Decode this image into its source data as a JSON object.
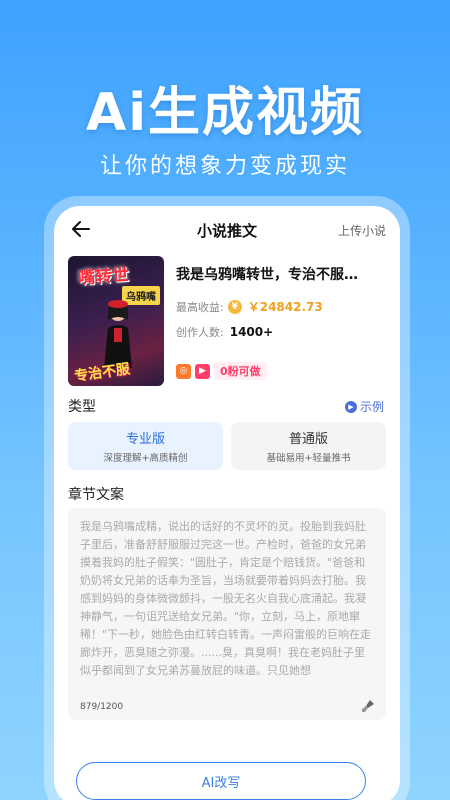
{
  "promo": {
    "title": "Ai生成视频",
    "subtitle": "让你的想象力变成现实"
  },
  "nav": {
    "title": "小说推文",
    "upload": "上传小说"
  },
  "novel": {
    "cover_title": "嘴转世",
    "cover_tag": "乌鸦嘴",
    "cover_bottom": "专治不服",
    "name": "我是乌鸦嘴转世，专治不服…",
    "earnings_label": "最高收益:",
    "earnings_value": "￥24842.73",
    "creators_label": "创作人数:",
    "creators_value": "1400+",
    "badge_text": "0粉可做"
  },
  "type_section": {
    "label": "类型",
    "example": "示例",
    "versions": [
      {
        "name": "专业版",
        "desc": "深度理解+高质精创"
      },
      {
        "name": "普通版",
        "desc": "基础易用+轻量推书"
      }
    ]
  },
  "chapter": {
    "label": "章节文案",
    "text": "我是乌鸦嘴成精，说出的话好的不灵坏的灵。投胎到我妈肚子里后，准备舒舒服服过完这一世。产检时，爸爸的女兄弟摸着我妈的肚子假笑：\"圆肚子，肯定是个赔钱货。\"爸爸和奶奶将女兄弟的话奉为圣旨，当场就要带着妈妈去打胎。我感到妈妈的身体微微颤抖，一股无名火自我心底涌起。我凝神静气，一句诅咒送给女兄弟。\"你，立刻，马上，原地窜稀！\"下一秒，她脸色由红转白转青。一声闷雷般的巨响在走廊炸开，恶臭随之弥漫。......臭，真臭啊！我在老妈肚子里似乎都闻到了女兄弟苏蔓放屁的味道。只见她想",
    "counter": "879/1200"
  },
  "action": {
    "ai_rewrite": "AI改写"
  },
  "colors": {
    "accent": "#3a82e8",
    "gold": "#f0a020",
    "badge": "#ff3f6a"
  }
}
